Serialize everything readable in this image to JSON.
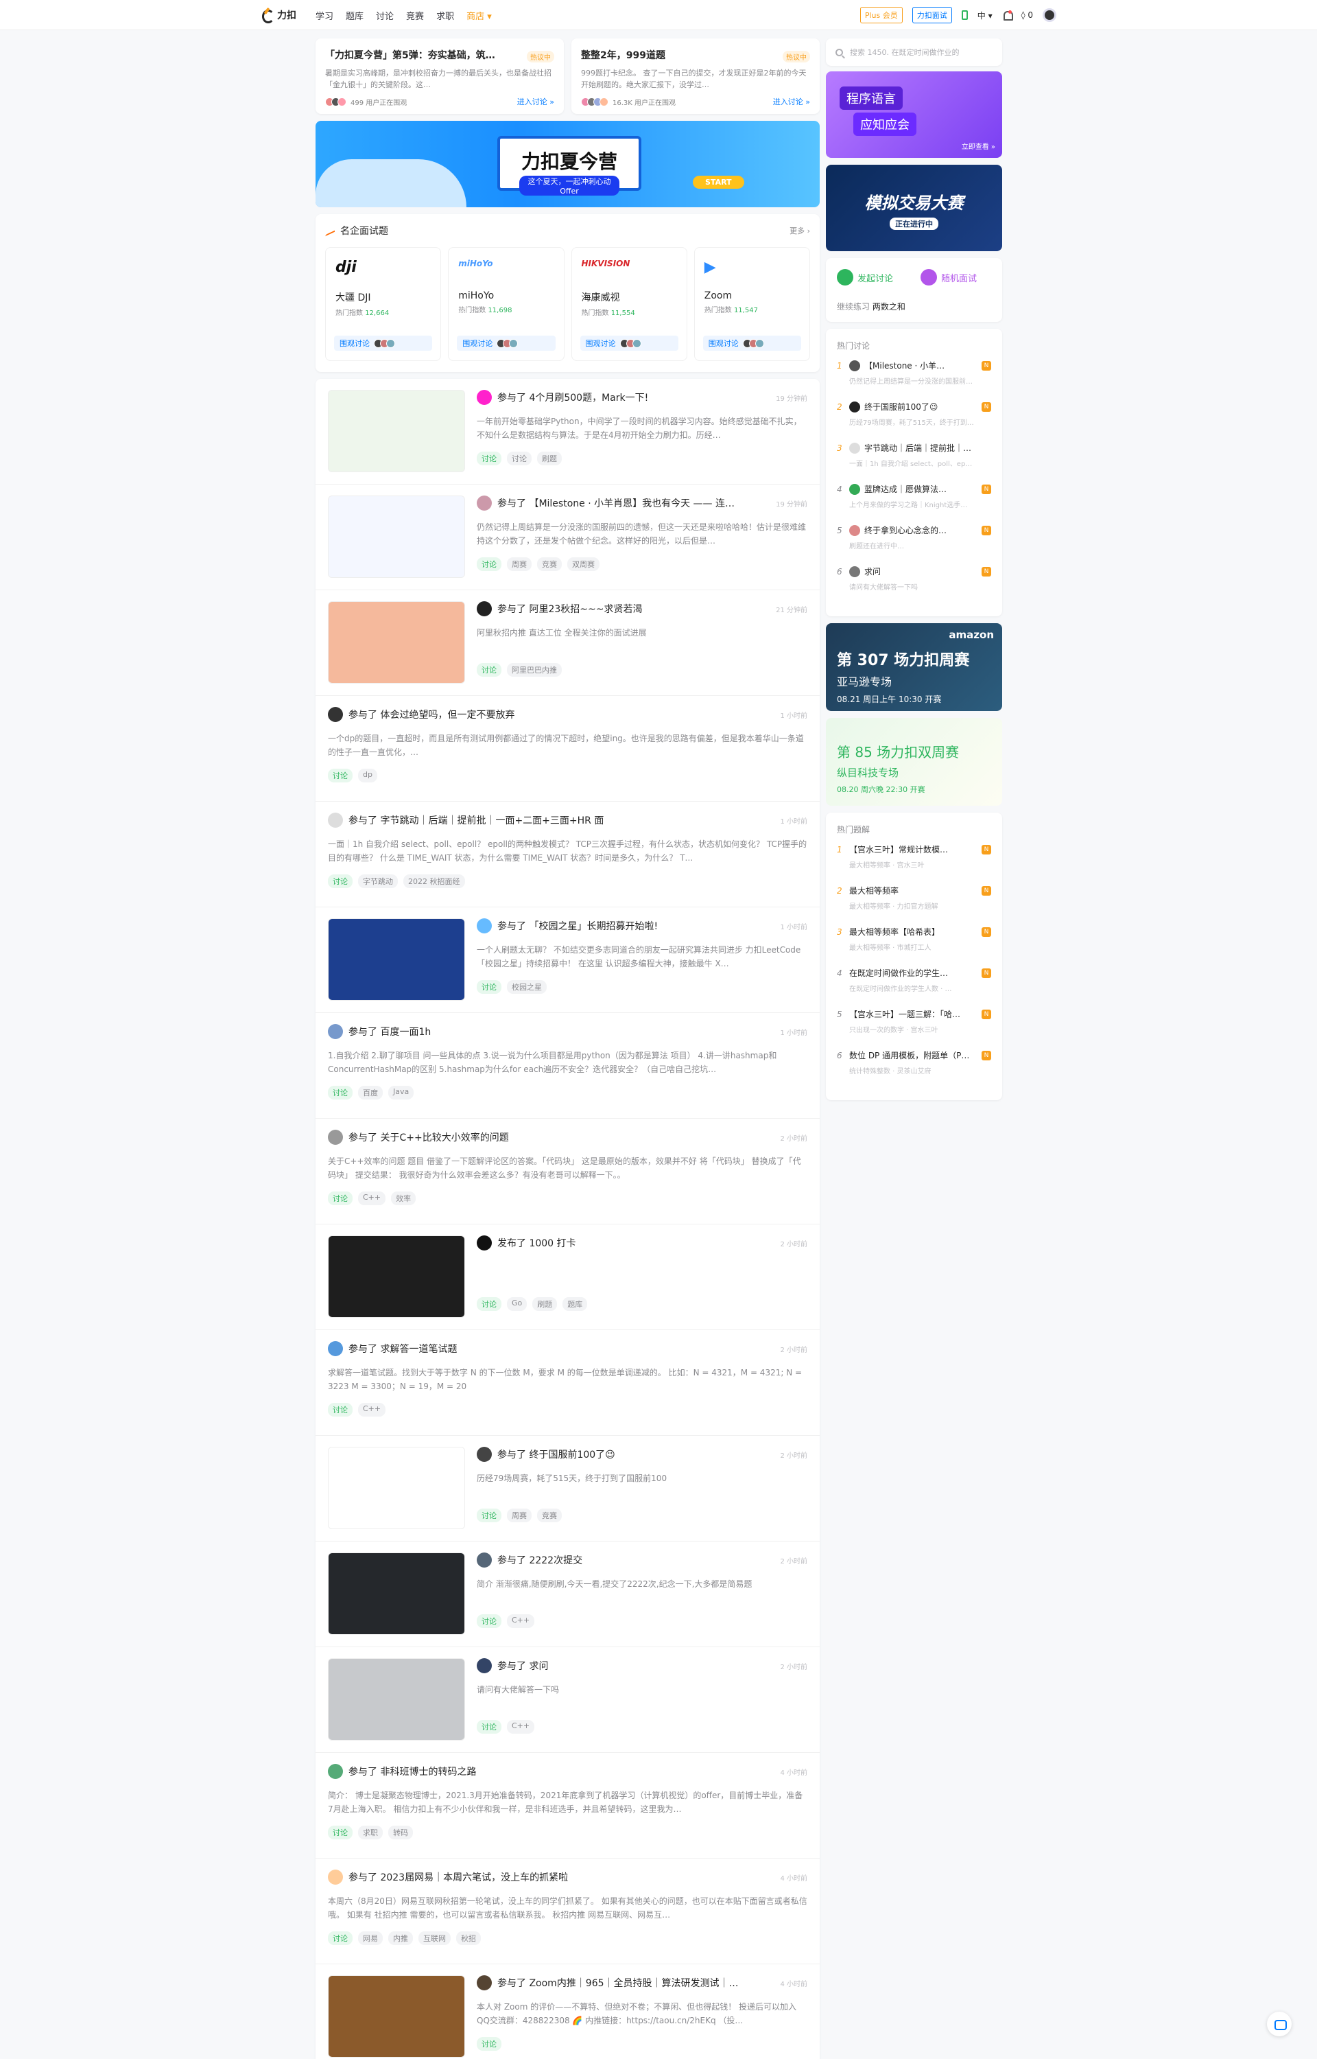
{
  "nav": {
    "logo": "力扣",
    "items": [
      "学习",
      "题库",
      "讨论",
      "竞赛",
      "求职"
    ],
    "store": "商店",
    "plus": "Plus 会员",
    "test": "力扣面试",
    "lang": "中",
    "points": "0"
  },
  "top_cards": [
    {
      "title": "「力扣夏今营」第5弹：夯实基础，筑…",
      "tag": "热议中",
      "desc": "暑期是实习高峰期，是冲刺校招奋力一搏的最后关头，也是备战社招「金九银十」的关键阶段。这…",
      "count": "499 用户正在围观",
      "link": "进入讨论"
    },
    {
      "title": "整整2年，999道题",
      "tag": "热议中",
      "desc": "999题打卡纪念。 查了一下自己的提交，才发现正好是2年前的今天开始刷题的。绝大家汇报下，没学过…",
      "count": "16.3K 用户正在围观",
      "link": "进入讨论"
    }
  ],
  "banner": {
    "title": "力扣夏今营",
    "sub": "这个夏天，一起冲刺心动 Offer",
    "start": "START"
  },
  "companies_section": {
    "title": "名企面试题",
    "more": "更多",
    "items": [
      {
        "logo": "dji",
        "name": "大疆 DJI",
        "count_label": "热门指数",
        "count": "12,664",
        "button": "围观讨论",
        "color": "#111111"
      },
      {
        "logo": "miHoYo",
        "name": "miHoYo",
        "count_label": "热门指数",
        "count": "11,698",
        "button": "围观讨论",
        "color": "#4a9bff"
      },
      {
        "logo": "HIKVISION",
        "name": "海康威视",
        "count_label": "热门指数",
        "count": "11,554",
        "button": "围观讨论",
        "color": "#d9262b"
      },
      {
        "logo": "▶",
        "name": "Zoom",
        "count_label": "热门指数",
        "count": "11,547",
        "button": "围观讨论",
        "color": "#2d8cff"
      }
    ]
  },
  "posts": [
    {
      "action": "参与了",
      "title": "4个月刷500题，Mark一下!",
      "time": "19 分钟前",
      "desc": "一年前开始零基础学Python，中间学了一段时间的机器学习内容。始终感觉基础不扎实，不知什么是数据结构与算法。于是在4月初开始全力刷力扣。历经…",
      "tags": [
        "讨论",
        "讨论",
        "刷题"
      ],
      "thumb": "#eef6ec"
    },
    {
      "action": "参与了",
      "title": "【Milestone · 小羊肖恩】我也有今天 —— 连…",
      "time": "19 分钟前",
      "desc": "仍然记得上周结算是一分没涨的国服前四的遗憾，但这一天还是来啦哈哈哈！估计是很难维持这个分数了，还是发个帖做个纪念。这样好的阳光，以后但是…",
      "tags": [
        "讨论",
        "周赛",
        "竞赛",
        "双周赛"
      ],
      "thumb": "#f4f7ff"
    },
    {
      "action": "参与了",
      "title": "阿里23秋招~~~求贤若渴",
      "time": "21 分钟前",
      "desc": "阿里秋招内推 直达工位 全程关注你的面试进展",
      "tags": [
        "讨论",
        "阿里巴巴内推"
      ],
      "thumb": "#f5b99c"
    },
    {
      "action": "参与了",
      "title": "体会过绝望吗，但一定不要放弃",
      "time": "1 小时前",
      "desc": "一个dp的题目，一直超时，而且是所有测试用例都通过了的情况下超时，绝望ing。也许是我的思路有偏差，但是我本着华山一条道的性子一直一直优化，…",
      "tags": [
        "讨论",
        "dp"
      ],
      "thumb": ""
    },
    {
      "action": "参与了",
      "title": "字节跳动｜后端｜提前批｜一面+二面+三面+HR 面",
      "time": "1 小时前",
      "desc": "一面｜1h 自我介绍 select、poll、epoll？ epoll的两种触发模式？ TCP三次握手过程，有什么状态，状态机如何变化？ TCP握手的目的有哪些？ 什么是 TIME_WAIT 状态，为什么需要 TIME_WAIT 状态？时间是多久，为什么？ T…",
      "tags": [
        "讨论",
        "字节跳动",
        "2022 秋招面经"
      ],
      "thumb": ""
    },
    {
      "action": "参与了",
      "title": "「校园之星」长期招募开始啦!",
      "time": "1 小时前",
      "desc": "一个人刷题太无聊？ 不如结交更多志同道合的朋友一起研究算法共同进步 力扣LeetCode「校园之星」持续招募中！ 在这里 认识超多编程大神，接触最牛 X…",
      "tags": [
        "讨论",
        "校园之星"
      ],
      "thumb": "#1d3f8f"
    },
    {
      "action": "参与了",
      "title": "百度一面1h",
      "time": "1 小时前",
      "desc": "1.自我介绍 2.聊了聊项目 问一些具体的点 3.说一说为什么项目都是用python（因为都是算法 项目） 4.讲一讲hashmap和ConcurrentHashMap的区别 5.hashmap为什么for each遍历不安全？迭代器安全？（自己啥自己挖坑…",
      "tags": [
        "讨论",
        "百度",
        "Java"
      ],
      "thumb": ""
    },
    {
      "action": "参与了",
      "title": "关于C++比较大小效率的问题",
      "time": "2 小时前",
      "desc": "关于C++效率的问题 题目 借鉴了一下题解评论区的答案。「代码块」 这是最原始的版本，效果并不好 将「代码块」 替换成了「代码块」 提交结果： 我很好奇为什么效率会差这么多？有没有老哥可以解释一下。。",
      "tags": [
        "讨论",
        "C++",
        "效率"
      ],
      "thumb": ""
    },
    {
      "action": "发布了",
      "title": "1000 打卡",
      "time": "2 小时前",
      "desc": "",
      "tags": [
        "讨论",
        "Go",
        "刷题",
        "题库"
      ],
      "thumb": "#1e1e1e"
    },
    {
      "action": "参与了",
      "title": "求解答一道笔试题",
      "time": "2 小时前",
      "desc": "求解答一道笔试题。找到大于等于数字 N 的下一位数 M，要求 M 的每一位数是单调递减的。 比如：N = 4321，M = 4321; N = 3223 M = 3300；N = 19，M = 20",
      "tags": [
        "讨论",
        "C++"
      ],
      "thumb": ""
    },
    {
      "action": "参与了",
      "title": "终于国服前100了😉",
      "time": "2 小时前",
      "desc": "历经79场周赛，耗了515天，终于打到了国服前100",
      "tags": [
        "讨论",
        "周赛",
        "竞赛"
      ],
      "thumb": "#ffffff"
    },
    {
      "action": "参与了",
      "title": "2222次提交",
      "time": "2 小时前",
      "desc": "简介 渐渐很痛,随便刷刷,今天一看,提交了2222次,纪念一下,大多都是简易题",
      "tags": [
        "讨论",
        "C++"
      ],
      "thumb": "#25282c"
    },
    {
      "action": "参与了",
      "title": "求问",
      "time": "2 小时前",
      "desc": "请问有大佬解答一下吗",
      "tags": [
        "讨论",
        "C++"
      ],
      "thumb": "#c7c9cc"
    },
    {
      "action": "参与了",
      "title": "非科班博士的转码之路",
      "time": "4 小时前",
      "desc": "简介： 博士是凝聚态物理博士，2021.3月开始准备转码，2021年底拿到了机器学习（计算机视觉）的offer，目前博士毕业，准备7月赴上海入职。 相信力扣上有不少小伙伴和我一样，是非科班选手，并且希望转码，这里我为…",
      "tags": [
        "讨论",
        "求职",
        "转码"
      ],
      "thumb": ""
    },
    {
      "action": "参与了",
      "title": "2023届网易｜本周六笔试，没上车的抓紧啦",
      "time": "4 小时前",
      "desc": "本周六（8月20日）网易互联网秋招第一轮笔试，没上车的同学们抓紧了。 如果有其他关心的问题，也可以在本贴下面留言或者私信哦。 如果有 社招内推 需要的，也可以留言或者私信联系我。 秋招内推 网易互联网、网易互…",
      "tags": [
        "讨论",
        "网易",
        "内推",
        "互联网",
        "秋招"
      ],
      "thumb": ""
    },
    {
      "action": "参与了",
      "title": "Zoom内推｜965｜全员持股｜算法研发测试｜…",
      "time": "4 小时前",
      "desc": "本人对 Zoom 的评价——不算特、但绝对不卷；不算闲、但也得起钱！ 投递后可以加入QQ交流群：428822308 🌈 内推链接：https://taou.cn/2hEKq （投…",
      "tags": [
        "讨论"
      ],
      "thumb": "#8b5a2b"
    }
  ],
  "sidebar": {
    "search_placeholder": "搜索 1450. 在既定时间做作业的",
    "ad1": {
      "line1": "程序语言",
      "line2": "应知应会",
      "more": "立即查看"
    },
    "ad2": {
      "title": "模拟交易大赛",
      "status": "正在进行中"
    },
    "actions": {
      "discuss": "发起讨论",
      "random": "随机面试",
      "practice_label": "继续练习",
      "practice_item": "两数之和"
    },
    "hot_discuss_title": "热门讨论",
    "hot_discuss": [
      {
        "num": "1",
        "title": "【Milestone · 小羊…",
        "sub": "仍然记得上周结算是一分没涨的国服前…"
      },
      {
        "num": "2",
        "title": "终于国服前100了😉",
        "sub": "历经79场周赛，耗了515天，终于打到…"
      },
      {
        "num": "3",
        "title": "字节跳动｜后端｜提前批｜…",
        "sub": "一面｜1h 自我介绍 select、poll、ep…"
      },
      {
        "num": "4",
        "title": "蓝牌达成｜愿做算法…",
        "sub": "上个月来做的学习之路｜Knight选手…"
      },
      {
        "num": "5",
        "title": "终于拿到心心念念的…",
        "sub": "刷题还在进行中…"
      },
      {
        "num": "6",
        "title": "求问",
        "sub": "请问有大佬解答一下吗"
      }
    ],
    "ad3": {
      "brand": "amazon",
      "title": "第 307 场力扣周赛",
      "sub": "亚马逊专场",
      "date": "08.21 周日上午 10:30 开赛"
    },
    "ad4": {
      "title": "第 85 场力扣双周赛",
      "sub": "纵目科技专场",
      "date": "08.20 周六晚 22:30 开赛"
    },
    "hot_solutions_title": "热门题解",
    "hot_solutions": [
      {
        "num": "1",
        "title": "【宫水三叶】常规计数模…",
        "sub": "最大相等频率 · 宫水三叶"
      },
      {
        "num": "2",
        "title": "最大相等频率",
        "sub": "最大相等频率 · 力扣官方题解"
      },
      {
        "num": "3",
        "title": "最大相等频率【哈希表】",
        "sub": "最大相等频率 · 市城打工人"
      },
      {
        "num": "4",
        "title": "在既定时间做作业的学生…",
        "sub": "在既定时间做作业的学生人数 · …"
      },
      {
        "num": "5",
        "title": "【宫水三叶】一题三解：「哈…",
        "sub": "只出现一次的数字 · 宫水三叶"
      },
      {
        "num": "6",
        "title": "数位 DP 通用模板，附题单（P…",
        "sub": "统计特殊整数 · 灵茶山艾府"
      }
    ]
  }
}
